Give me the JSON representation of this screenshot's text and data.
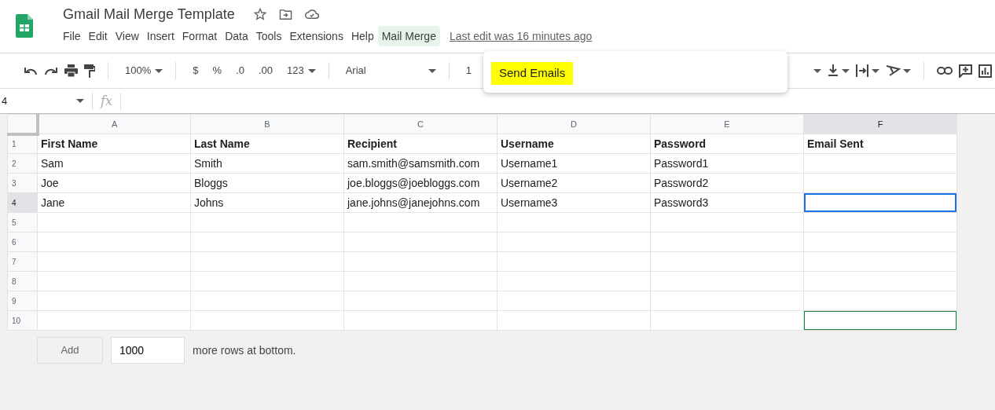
{
  "document": {
    "title": "Gmail Mail Merge Template"
  },
  "menu": [
    {
      "label": "File",
      "selected": false
    },
    {
      "label": "Edit",
      "selected": false
    },
    {
      "label": "View",
      "selected": false
    },
    {
      "label": "Insert",
      "selected": false
    },
    {
      "label": "Format",
      "selected": false
    },
    {
      "label": "Data",
      "selected": false
    },
    {
      "label": "Tools",
      "selected": false
    },
    {
      "label": "Extensions",
      "selected": false
    },
    {
      "label": "Help",
      "selected": false
    },
    {
      "label": "Mail Merge",
      "selected": true
    }
  ],
  "last_edit": "Last edit was 16 minutes ago",
  "dropdown": {
    "items": [
      {
        "label": "Send Emails",
        "highlighted": true
      }
    ]
  },
  "toolbar": {
    "zoom": "100%",
    "currency": "$",
    "percent": "%",
    "decrease_decimal": ".0",
    "increase_decimal": ".00",
    "number_format": "123",
    "font": "Arial",
    "font_size": "1"
  },
  "formula_bar": {
    "cell_ref": "4",
    "fx": "fx"
  },
  "grid": {
    "columns": [
      {
        "label": "A",
        "selected": false
      },
      {
        "label": "B",
        "selected": false
      },
      {
        "label": "C",
        "selected": false
      },
      {
        "label": "D",
        "selected": false
      },
      {
        "label": "E",
        "selected": false
      },
      {
        "label": "F",
        "selected": true
      }
    ],
    "rows": [
      {
        "header": "1",
        "kind": "header",
        "selected": false,
        "outlined": false,
        "cells": [
          "First Name",
          "Last Name",
          "Recipient",
          "Username",
          "Password",
          "Email Sent"
        ]
      },
      {
        "header": "2",
        "kind": "data",
        "selected": false,
        "outlined": false,
        "cells": [
          "Sam",
          "Smith",
          "sam.smith@samsmith.com",
          "Username1",
          "Password1",
          ""
        ]
      },
      {
        "header": "3",
        "kind": "data",
        "selected": false,
        "outlined": false,
        "cells": [
          "Joe",
          "Bloggs",
          "joe.bloggs@joebloggs.com",
          "Username2",
          "Password2",
          ""
        ]
      },
      {
        "header": "4",
        "kind": "data",
        "selected": true,
        "outlined": false,
        "cells": [
          "Jane",
          "Johns",
          "jane.johns@janejohns.com",
          "Username3",
          "Password3",
          ""
        ]
      },
      {
        "header": "5",
        "kind": "data",
        "selected": false,
        "outlined": false,
        "cells": [
          "",
          "",
          "",
          "",
          "",
          ""
        ]
      },
      {
        "header": "6",
        "kind": "data",
        "selected": false,
        "outlined": false,
        "cells": [
          "",
          "",
          "",
          "",
          "",
          ""
        ]
      },
      {
        "header": "7",
        "kind": "data",
        "selected": false,
        "outlined": false,
        "cells": [
          "",
          "",
          "",
          "",
          "",
          ""
        ]
      },
      {
        "header": "8",
        "kind": "data",
        "selected": false,
        "outlined": false,
        "cells": [
          "",
          "",
          "",
          "",
          "",
          ""
        ]
      },
      {
        "header": "9",
        "kind": "data",
        "selected": false,
        "outlined": false,
        "cells": [
          "",
          "",
          "",
          "",
          "",
          ""
        ]
      },
      {
        "header": "10",
        "kind": "data",
        "selected": false,
        "outlined": true,
        "cells": [
          "",
          "",
          "",
          "",
          "",
          ""
        ]
      }
    ]
  },
  "footer": {
    "add_button": "Add",
    "row_count": "1000",
    "note": "more rows at bottom."
  }
}
